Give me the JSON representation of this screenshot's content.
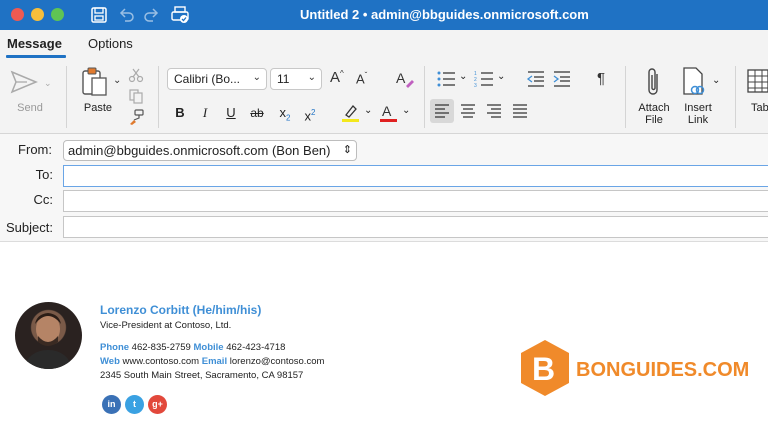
{
  "window": {
    "title": "Untitled 2 • admin@bbguides.onmicrosoft.com",
    "colors": {
      "titlebar": "#1f72c4",
      "close": "#ee5a52",
      "minimize": "#f6be3b",
      "zoom": "#5fc454"
    }
  },
  "tabs": [
    {
      "label": "Message",
      "active": true
    },
    {
      "label": "Options",
      "active": false
    }
  ],
  "ribbon": {
    "send_label": "Send",
    "paste_label": "Paste",
    "font_name": "Calibri (Bo...",
    "font_size": "11",
    "bold": "B",
    "italic": "I",
    "underline": "U",
    "strike": "ab",
    "subscript": "x",
    "superscript": "x",
    "paragraph_mark": "¶",
    "attach_label_1": "Attach",
    "attach_label_2": "File",
    "insert_label_1": "Insert",
    "insert_label_2": "Link",
    "table_label": "Tab"
  },
  "fields": {
    "from_label": "From:",
    "from_value": "admin@bbguides.onmicrosoft.com (Bon Ben)",
    "to_label": "To:",
    "cc_label": "Cc:",
    "subject_label": "Subject:"
  },
  "signature": {
    "name": "Lorenzo Corbitt (He/him/his)",
    "title": "Vice-President at Contoso, Ltd.",
    "phone_label": "Phone",
    "phone": "462-835-2759",
    "mobile_label": "Mobile",
    "mobile": "462-423-4718",
    "web_label": "Web",
    "web": "www.contoso.com",
    "email_label": "Email",
    "email": "lorenzo@contoso.com",
    "address": "2345 South Main Street, Sacramento, CA 98157",
    "social": [
      {
        "icon": "linkedin-icon",
        "text": "in",
        "color": "#3a71b6"
      },
      {
        "icon": "twitter-icon",
        "text": "t",
        "color": "#3aa1e2"
      },
      {
        "icon": "google-plus-icon",
        "text": "g+",
        "color": "#e2483b"
      }
    ]
  },
  "watermark": {
    "letter": "B",
    "text": "BONGUIDES.COM",
    "color": "#f08a2a"
  }
}
